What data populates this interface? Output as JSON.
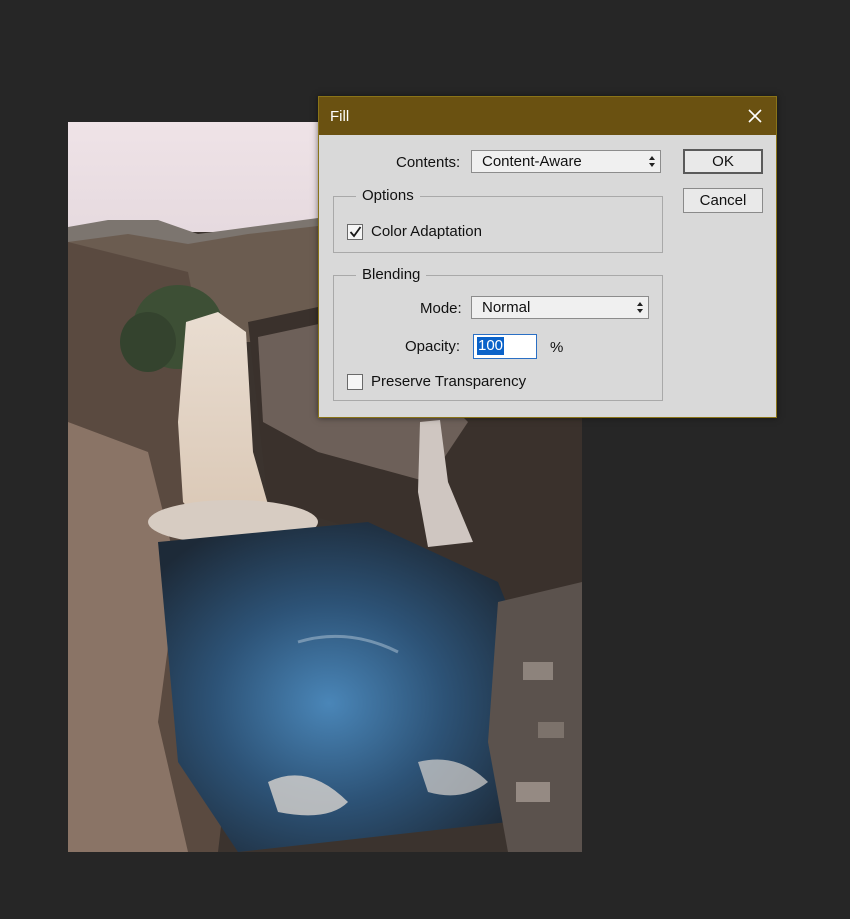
{
  "dialog": {
    "title": "Fill",
    "contents_label": "Contents:",
    "contents_value": "Content-Aware",
    "ok_label": "OK",
    "cancel_label": "Cancel",
    "options_title": "Options",
    "color_adaptation_label": "Color Adaptation",
    "color_adaptation_checked": true,
    "blending_title": "Blending",
    "mode_label": "Mode:",
    "mode_value": "Normal",
    "opacity_label": "Opacity:",
    "opacity_value": "100",
    "opacity_unit": "%",
    "preserve_transparency_label": "Preserve Transparency",
    "preserve_transparency_checked": false
  },
  "canvas": {
    "image_subject": "waterfall-gorge-photo"
  },
  "colors": {
    "workspace_bg": "#262626",
    "titlebar_bg": "#6a5111",
    "dialog_bg": "#d9d9d9",
    "selection_blue": "#0a62c9"
  }
}
